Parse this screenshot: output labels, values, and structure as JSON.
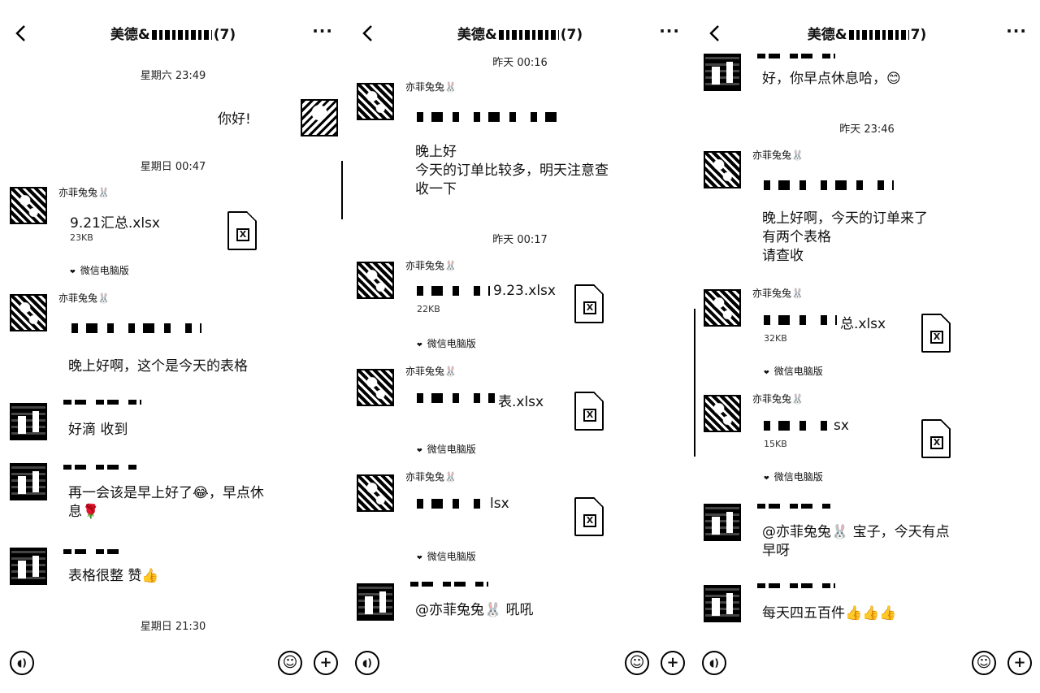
{
  "header": {
    "title_prefix": "美德&",
    "title_suffix_a": "(7)",
    "title_suffix_b": "(7)",
    "title_suffix_c": "7)",
    "more": "···"
  },
  "panel1": {
    "ts1": "星期六 23:49",
    "me_text": "你好!",
    "ts2": "星期日 00:47",
    "nick1": "亦菲兔兔🐰",
    "file1_name": "9.21汇总.xlsx",
    "file1_size": "23KB",
    "src1": "微信电脑版",
    "nick2": "亦菲兔兔🐰",
    "msg2": "晚上好啊，这个是今天的表格",
    "msg3": "好滴 收到",
    "msg4_l1": "再一会该是早上好了😂，早点休",
    "msg4_l2": "息🌹",
    "msg5": "表格很整 赞👍",
    "ts3": "星期日 21:30"
  },
  "panel2": {
    "ts1": "昨天 00:16",
    "nick1": "亦菲兔兔🐰",
    "msg1_l1": "晚上好",
    "msg1_l2": "今天的订单比较多，明天注意查",
    "msg1_l3": "收一下",
    "ts2": "昨天 00:17",
    "nick2": "亦菲兔兔🐰",
    "file2_name": "9.23.xlsx",
    "file2_size": "22KB",
    "src2": "微信电脑版",
    "nick3": "亦菲兔兔🐰",
    "file3_name": "表.xlsx",
    "src3": "微信电脑版",
    "nick4": "亦菲兔兔🐰",
    "file4_name": "lsx",
    "src4": "微信电脑版",
    "msg5": "@亦菲兔兔🐰 吼吼"
  },
  "panel3": {
    "msg0": "好，你早点休息哈，😊",
    "ts1": "昨天 23:46",
    "nick1": "亦菲兔兔🐰",
    "msg1_l1": "晚上好啊，今天的订单来了",
    "msg1_l2": "有两个表格",
    "msg1_l3": "请查收",
    "nick2": "亦菲兔兔🐰",
    "file2_name": "总.xlsx",
    "file2_size": "32KB",
    "src2": "微信电脑版",
    "nick3": "亦菲兔兔🐰",
    "file3_name": "sx",
    "file3_size": "15KB",
    "src3": "微信电脑版",
    "msg4_l1": "@亦菲兔兔🐰 宝子，今天有点",
    "msg4_l2": "早呀",
    "msg5": "每天四五百件👍👍👍"
  },
  "icons": {
    "voice": "voice-icon",
    "emoji": "emoji-icon",
    "plus": "plus-icon",
    "file": "excel-file-icon"
  },
  "labels": {
    "excel_mark": "X",
    "emoji": "☺",
    "plus": "+",
    "voice": "◖)"
  }
}
